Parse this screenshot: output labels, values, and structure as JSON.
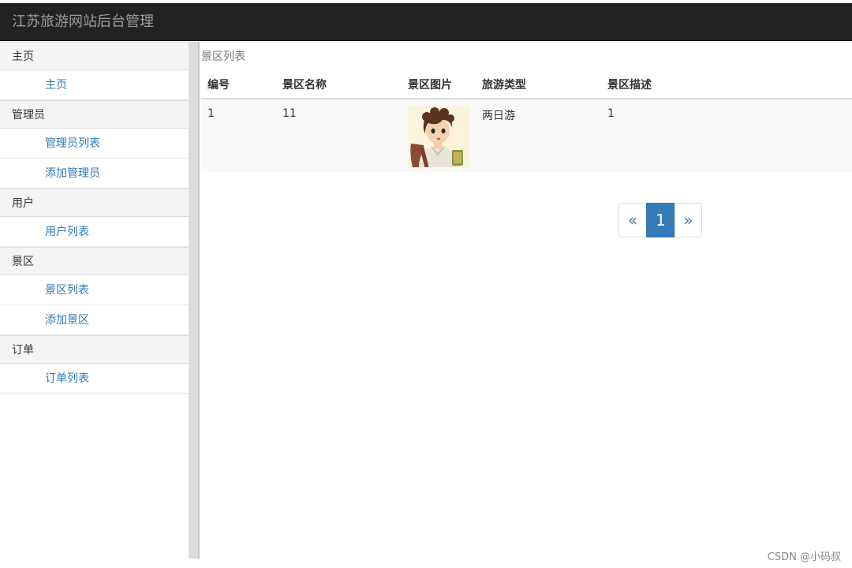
{
  "header": {
    "title": "江苏旅游网站后台管理"
  },
  "sidebar": {
    "sections": [
      {
        "title": "主页",
        "items": [
          "主页"
        ]
      },
      {
        "title": "管理员",
        "items": [
          "管理员列表",
          "添加管理员"
        ]
      },
      {
        "title": "用户",
        "items": [
          "用户列表"
        ]
      },
      {
        "title": "景区",
        "items": [
          "景区列表",
          "添加景区"
        ]
      },
      {
        "title": "订单",
        "items": [
          "订单列表"
        ]
      }
    ]
  },
  "main": {
    "breadcrumb": "景区列表",
    "table": {
      "headers": [
        "编号",
        "景区名称",
        "景区图片",
        "旅游类型",
        "景区描述"
      ],
      "rows": [
        {
          "id": "1",
          "name": "11",
          "image": "portrait-thumbnail",
          "type": "两日游",
          "description": "1"
        }
      ]
    },
    "pagination": {
      "prev": "«",
      "current": "1",
      "next": "»"
    }
  },
  "watermark": "CSDN @小码叔",
  "colors": {
    "topbar": "#222222",
    "link": "#337ab7",
    "active_page": "#337ab7"
  }
}
